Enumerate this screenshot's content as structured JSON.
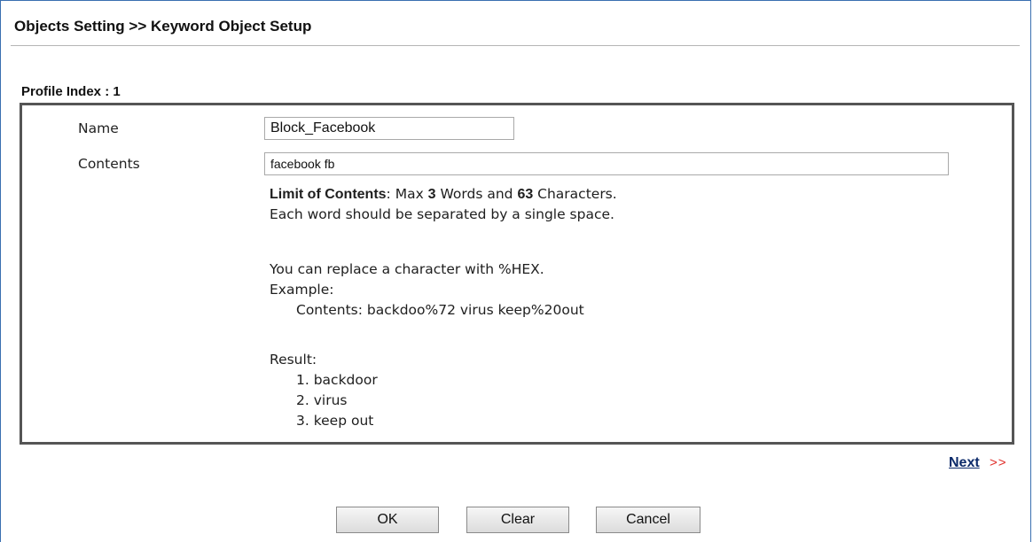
{
  "header": {
    "title": "Objects Setting >> Keyword Object Setup"
  },
  "profile": {
    "index_label": "Profile Index : 1"
  },
  "form": {
    "name_label": "Name",
    "name_value": "Block_Facebook",
    "contents_label": "Contents",
    "contents_value": "facebook fb"
  },
  "help": {
    "limit_label": "Limit of Contents",
    "limit_text_1": ": Max ",
    "max_words": "3",
    "limit_text_2": " Words and ",
    "max_chars": "63",
    "limit_text_3": " Characters.",
    "separator_note": "Each word should be separated by a single space.",
    "replace_note": "You can replace a character with %HEX.",
    "example_label": "Example:",
    "example_contents": "Contents: backdoo%72 virus keep%20out",
    "result_label": "Result:",
    "results": [
      "1. backdoor",
      "2. virus",
      "3. keep out"
    ]
  },
  "nav": {
    "next_label": "Next",
    "next_arrows": ">>"
  },
  "buttons": {
    "ok": "OK",
    "clear": "Clear",
    "cancel": "Cancel"
  },
  "colors": {
    "frame_border": "#3a6fb0",
    "next_link": "#0c2a6a",
    "next_arrows": "#e0302b"
  }
}
